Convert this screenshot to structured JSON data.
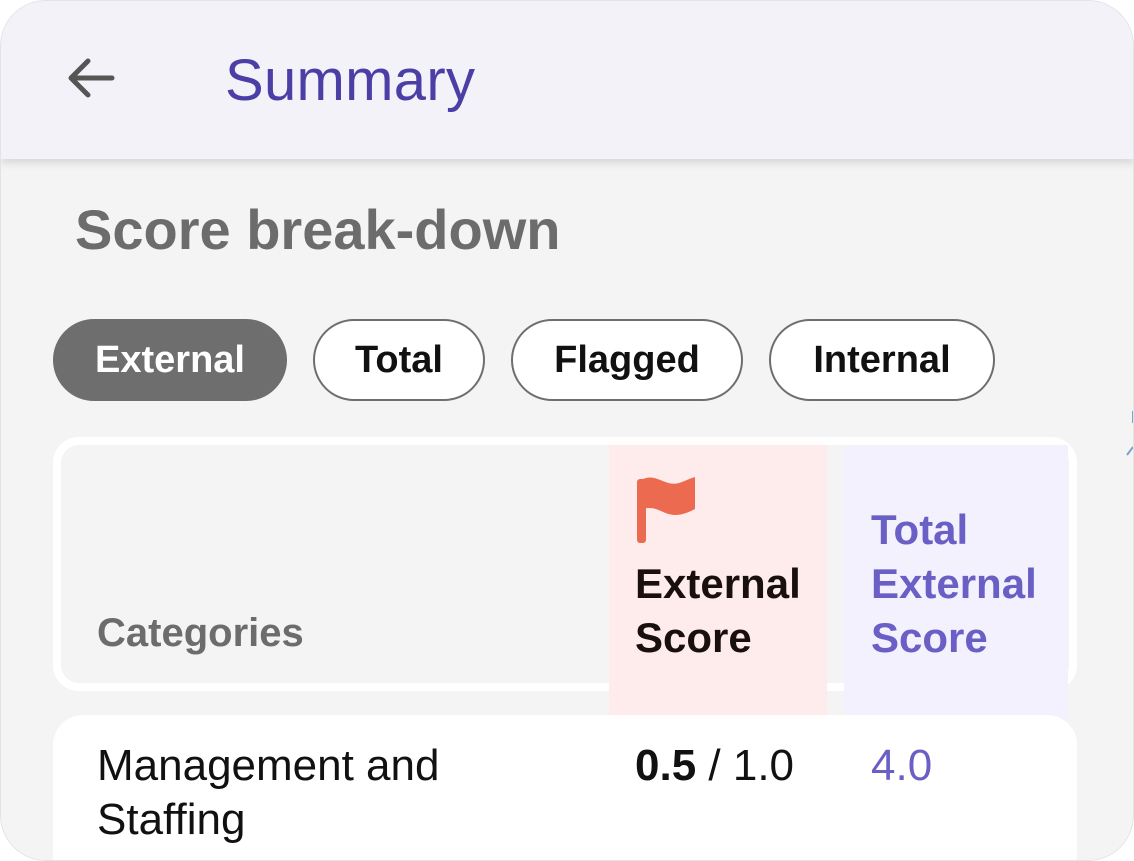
{
  "appbar": {
    "title": "Summary",
    "back_icon": "arrow-left-icon"
  },
  "section": {
    "title": "Score break-down"
  },
  "filters": [
    {
      "label": "External",
      "active": true
    },
    {
      "label": "Total",
      "active": false
    },
    {
      "label": "Flagged",
      "active": false
    },
    {
      "label": "Internal",
      "active": false
    }
  ],
  "table": {
    "headers": {
      "categories": "Categories",
      "external_score": "External Score",
      "total_external_score": "Total External Score",
      "flag_icon": "flag-icon"
    },
    "rows": [
      {
        "category": "Management and Staffing",
        "score": "0.5",
        "max": "/ 1.0",
        "total": "4.0"
      }
    ]
  },
  "colors": {
    "accent": "#4b3fa6",
    "total_text": "#6a5fc4",
    "flag": "#ec6a4f",
    "external_col_bg": "#fdeceb",
    "total_col_bg": "#f3f1fd",
    "chip_active": "#6e6e6e"
  }
}
